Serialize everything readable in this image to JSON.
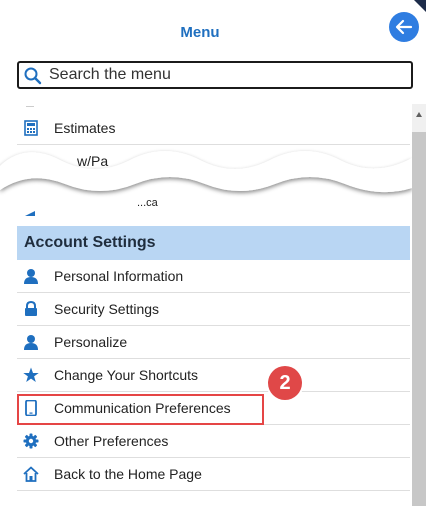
{
  "header": {
    "title": "Menu"
  },
  "search": {
    "placeholder": "Search the menu"
  },
  "menu_items_top": [
    {
      "label": "Estimates",
      "icon": "calculator-icon"
    },
    {
      "label": "w/Pa",
      "icon": ""
    }
  ],
  "partial_fragment": "...ca",
  "section": {
    "title": "Account Settings"
  },
  "account_items": [
    {
      "label": "Personal Information",
      "icon": "user-icon"
    },
    {
      "label": "Security Settings",
      "icon": "lock-icon"
    },
    {
      "label": "Personalize",
      "icon": "user-icon"
    },
    {
      "label": "Change Your Shortcuts",
      "icon": "star-icon"
    },
    {
      "label": "Communication Preferences",
      "icon": "mobile-phone-icon"
    },
    {
      "label": "Other Preferences",
      "icon": "gear-icon"
    },
    {
      "label": "Back to the Home Page",
      "icon": "home-icon"
    }
  ],
  "annotation": {
    "step": "2"
  },
  "colors": {
    "accent": "#2f7de1",
    "section_bg": "#b9d6f3",
    "highlight": "#e54545",
    "badge": "#e04848"
  }
}
